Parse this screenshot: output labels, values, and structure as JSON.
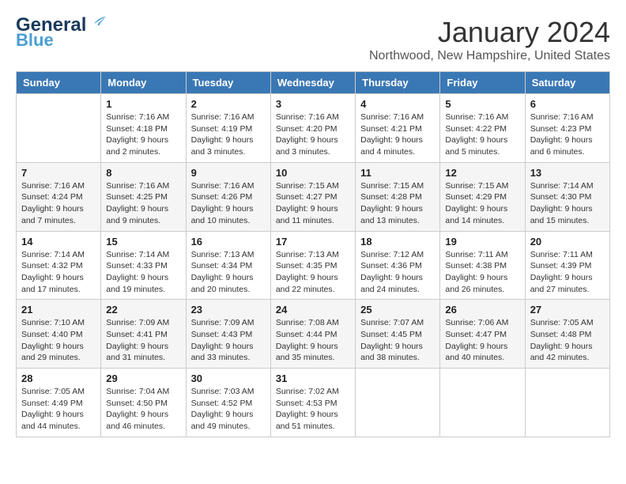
{
  "header": {
    "logo_line1": "General",
    "logo_line2": "Blue",
    "month_year": "January 2024",
    "location": "Northwood, New Hampshire, United States"
  },
  "weekdays": [
    "Sunday",
    "Monday",
    "Tuesday",
    "Wednesday",
    "Thursday",
    "Friday",
    "Saturday"
  ],
  "weeks": [
    [
      {
        "day": "",
        "text": ""
      },
      {
        "day": "1",
        "text": "Sunrise: 7:16 AM\nSunset: 4:18 PM\nDaylight: 9 hours\nand 2 minutes."
      },
      {
        "day": "2",
        "text": "Sunrise: 7:16 AM\nSunset: 4:19 PM\nDaylight: 9 hours\nand 3 minutes."
      },
      {
        "day": "3",
        "text": "Sunrise: 7:16 AM\nSunset: 4:20 PM\nDaylight: 9 hours\nand 3 minutes."
      },
      {
        "day": "4",
        "text": "Sunrise: 7:16 AM\nSunset: 4:21 PM\nDaylight: 9 hours\nand 4 minutes."
      },
      {
        "day": "5",
        "text": "Sunrise: 7:16 AM\nSunset: 4:22 PM\nDaylight: 9 hours\nand 5 minutes."
      },
      {
        "day": "6",
        "text": "Sunrise: 7:16 AM\nSunset: 4:23 PM\nDaylight: 9 hours\nand 6 minutes."
      }
    ],
    [
      {
        "day": "7",
        "text": "Sunrise: 7:16 AM\nSunset: 4:24 PM\nDaylight: 9 hours\nand 7 minutes."
      },
      {
        "day": "8",
        "text": "Sunrise: 7:16 AM\nSunset: 4:25 PM\nDaylight: 9 hours\nand 9 minutes."
      },
      {
        "day": "9",
        "text": "Sunrise: 7:16 AM\nSunset: 4:26 PM\nDaylight: 9 hours\nand 10 minutes."
      },
      {
        "day": "10",
        "text": "Sunrise: 7:15 AM\nSunset: 4:27 PM\nDaylight: 9 hours\nand 11 minutes."
      },
      {
        "day": "11",
        "text": "Sunrise: 7:15 AM\nSunset: 4:28 PM\nDaylight: 9 hours\nand 13 minutes."
      },
      {
        "day": "12",
        "text": "Sunrise: 7:15 AM\nSunset: 4:29 PM\nDaylight: 9 hours\nand 14 minutes."
      },
      {
        "day": "13",
        "text": "Sunrise: 7:14 AM\nSunset: 4:30 PM\nDaylight: 9 hours\nand 15 minutes."
      }
    ],
    [
      {
        "day": "14",
        "text": "Sunrise: 7:14 AM\nSunset: 4:32 PM\nDaylight: 9 hours\nand 17 minutes."
      },
      {
        "day": "15",
        "text": "Sunrise: 7:14 AM\nSunset: 4:33 PM\nDaylight: 9 hours\nand 19 minutes."
      },
      {
        "day": "16",
        "text": "Sunrise: 7:13 AM\nSunset: 4:34 PM\nDaylight: 9 hours\nand 20 minutes."
      },
      {
        "day": "17",
        "text": "Sunrise: 7:13 AM\nSunset: 4:35 PM\nDaylight: 9 hours\nand 22 minutes."
      },
      {
        "day": "18",
        "text": "Sunrise: 7:12 AM\nSunset: 4:36 PM\nDaylight: 9 hours\nand 24 minutes."
      },
      {
        "day": "19",
        "text": "Sunrise: 7:11 AM\nSunset: 4:38 PM\nDaylight: 9 hours\nand 26 minutes."
      },
      {
        "day": "20",
        "text": "Sunrise: 7:11 AM\nSunset: 4:39 PM\nDaylight: 9 hours\nand 27 minutes."
      }
    ],
    [
      {
        "day": "21",
        "text": "Sunrise: 7:10 AM\nSunset: 4:40 PM\nDaylight: 9 hours\nand 29 minutes."
      },
      {
        "day": "22",
        "text": "Sunrise: 7:09 AM\nSunset: 4:41 PM\nDaylight: 9 hours\nand 31 minutes."
      },
      {
        "day": "23",
        "text": "Sunrise: 7:09 AM\nSunset: 4:43 PM\nDaylight: 9 hours\nand 33 minutes."
      },
      {
        "day": "24",
        "text": "Sunrise: 7:08 AM\nSunset: 4:44 PM\nDaylight: 9 hours\nand 35 minutes."
      },
      {
        "day": "25",
        "text": "Sunrise: 7:07 AM\nSunset: 4:45 PM\nDaylight: 9 hours\nand 38 minutes."
      },
      {
        "day": "26",
        "text": "Sunrise: 7:06 AM\nSunset: 4:47 PM\nDaylight: 9 hours\nand 40 minutes."
      },
      {
        "day": "27",
        "text": "Sunrise: 7:05 AM\nSunset: 4:48 PM\nDaylight: 9 hours\nand 42 minutes."
      }
    ],
    [
      {
        "day": "28",
        "text": "Sunrise: 7:05 AM\nSunset: 4:49 PM\nDaylight: 9 hours\nand 44 minutes."
      },
      {
        "day": "29",
        "text": "Sunrise: 7:04 AM\nSunset: 4:50 PM\nDaylight: 9 hours\nand 46 minutes."
      },
      {
        "day": "30",
        "text": "Sunrise: 7:03 AM\nSunset: 4:52 PM\nDaylight: 9 hours\nand 49 minutes."
      },
      {
        "day": "31",
        "text": "Sunrise: 7:02 AM\nSunset: 4:53 PM\nDaylight: 9 hours\nand 51 minutes."
      },
      {
        "day": "",
        "text": ""
      },
      {
        "day": "",
        "text": ""
      },
      {
        "day": "",
        "text": ""
      }
    ]
  ]
}
